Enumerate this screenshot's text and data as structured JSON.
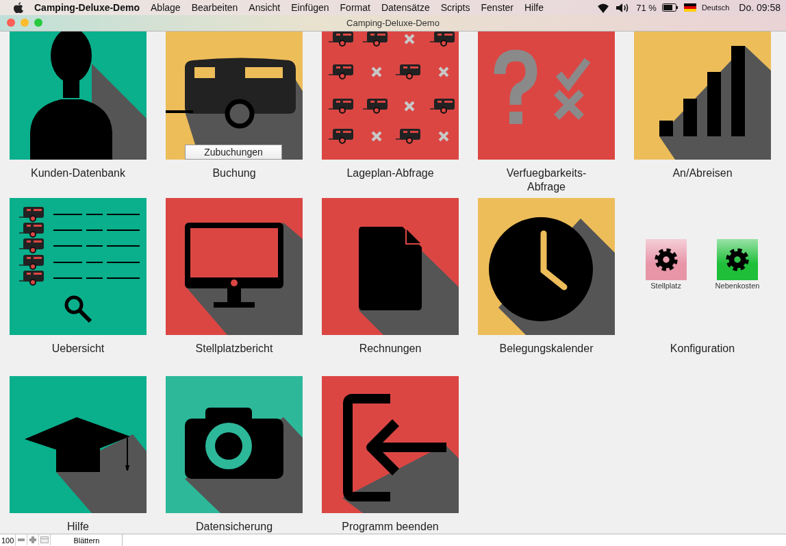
{
  "menu_bar": {
    "app_name": "Camping-Deluxe-Demo",
    "menus": [
      "Ablage",
      "Bearbeiten",
      "Ansicht",
      "Einfügen",
      "Format",
      "Datensätze",
      "Scripts",
      "Fenster",
      "Hilfe"
    ],
    "battery": "71 %",
    "input_source": "Deutsch",
    "clock": "Do. 09:58"
  },
  "window": {
    "title": "Camping-Deluxe-Demo"
  },
  "rows": [
    [
      {
        "kind": "person",
        "label": "Kunden-Datenbank",
        "color": "#0aaf8c"
      },
      {
        "kind": "caravan",
        "label": "Buchung",
        "color": "#edbd5a",
        "overlay_button": "Zubuchungen"
      },
      {
        "kind": "caravan-grid",
        "label": "Lageplan-Abfrage",
        "color": "#db4643"
      },
      {
        "kind": "question-check",
        "label": "Verfuegbarkeits-\nAbfrage",
        "color": "#db4643"
      },
      {
        "kind": "bar-chart",
        "label": "An/Abreisen",
        "color": "#edbd5a"
      }
    ],
    [
      {
        "kind": "list-search",
        "label": "Uebersicht",
        "color": "#0aaf8c"
      },
      {
        "kind": "monitor",
        "label": "Stellplatzbericht",
        "color": "#db4643"
      },
      {
        "kind": "document",
        "label": "Rechnungen",
        "color": "#db4643"
      },
      {
        "kind": "clock",
        "label": "Belegungskalender",
        "color": "#edbd5a"
      },
      {
        "kind": "config",
        "label": "Konfiguration",
        "buttons": [
          {
            "label": "Stellplatz",
            "color": "#e895a8"
          },
          {
            "label": "Nebenkosten",
            "color": "#1fbf3a"
          }
        ]
      }
    ],
    [
      {
        "kind": "graduation-cap",
        "label": "Hilfe",
        "color": "#0aaf8c"
      },
      {
        "kind": "camera",
        "label": "Datensicherung",
        "color": "#2db89a"
      },
      {
        "kind": "exit",
        "label": "Programm beenden",
        "color": "#db4643"
      }
    ]
  ],
  "status_bar": {
    "zoom": "100",
    "mode": "Blättern"
  }
}
